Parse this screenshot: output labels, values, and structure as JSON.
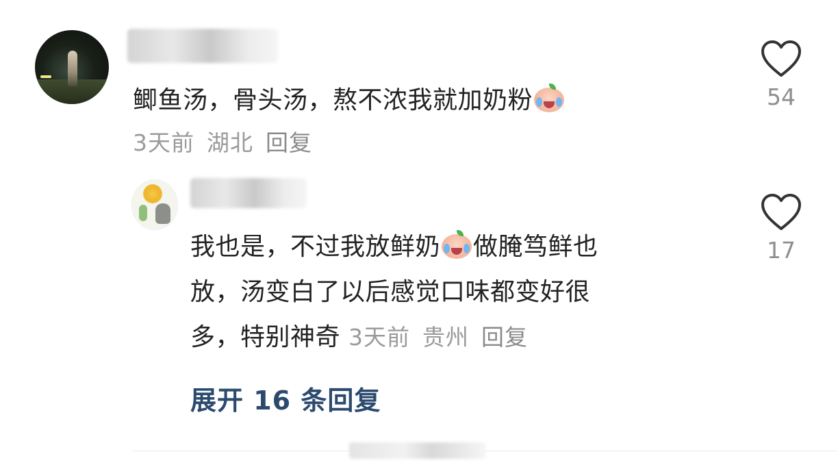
{
  "comments": [
    {
      "text_before": "鲫鱼汤，骨头汤，熬不浓我就加奶粉",
      "emoji": "crying-face-emoji",
      "time": "3天前",
      "location": "湖北",
      "reply_label": "回复",
      "likes": "54"
    }
  ],
  "reply": {
    "line1_before": "我也是，不过我放鲜奶",
    "emoji": "crying-face-emoji",
    "line1_after": "做腌笃鲜也",
    "line2": "放，汤变白了以后感觉口味都变好很",
    "line3": "多，特别神奇",
    "time": "3天前",
    "location": "贵州",
    "reply_label": "回复",
    "likes": "17"
  },
  "expand_label": "展开 16 条回复",
  "icons": {
    "like": "heart-outline-icon"
  },
  "colors": {
    "text": "#222222",
    "meta": "#9a9a9a",
    "expand": "#2b4a6e"
  }
}
